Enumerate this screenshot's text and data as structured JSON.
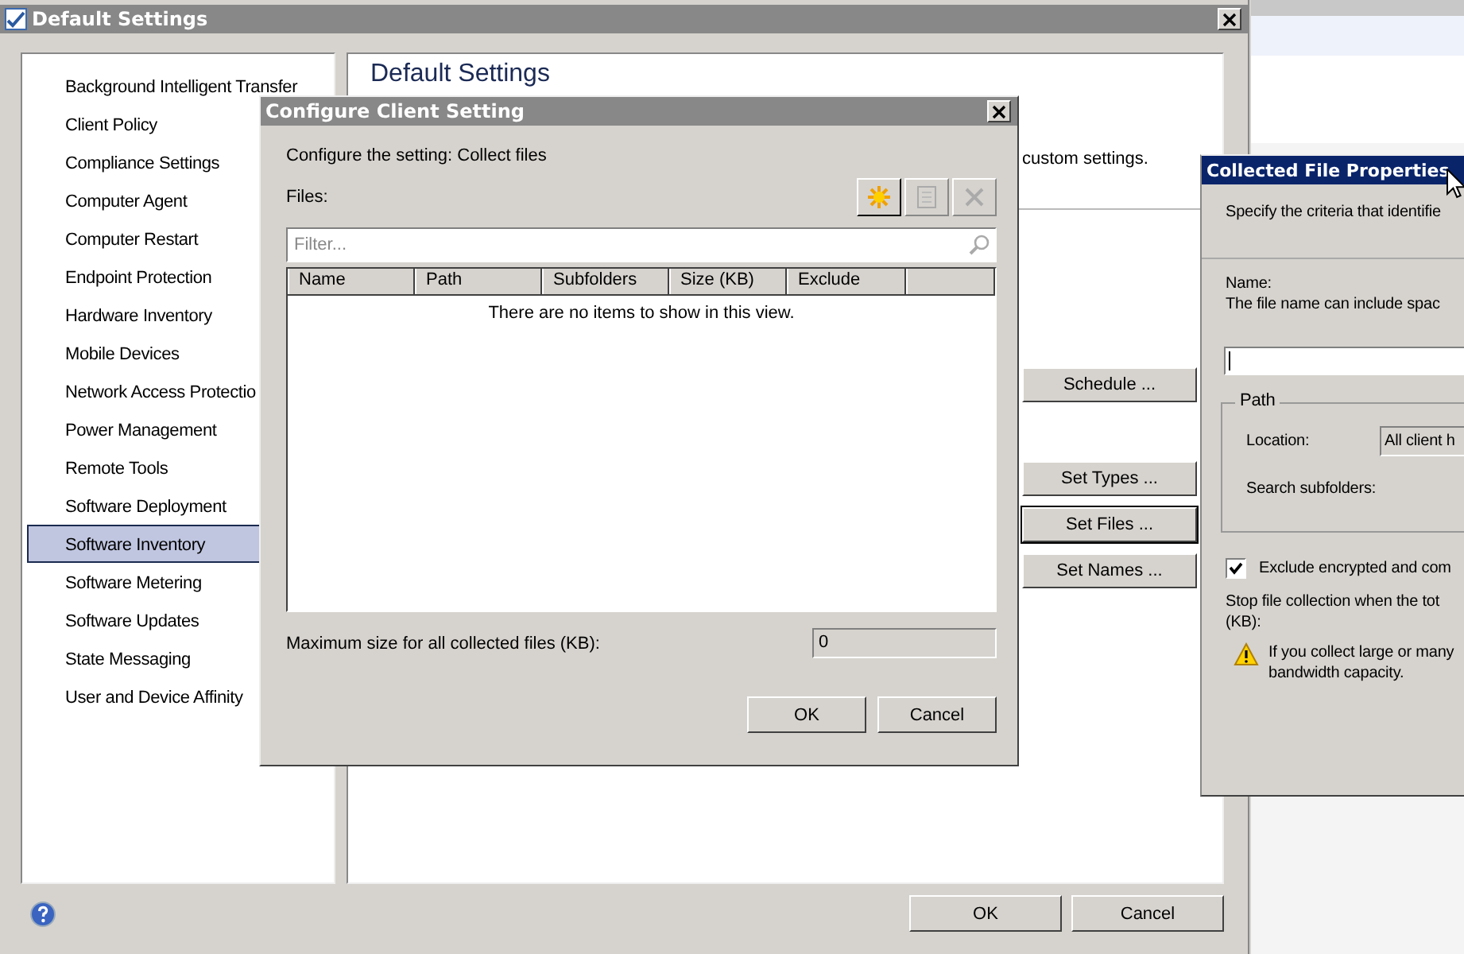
{
  "window": {
    "title": "Default Settings"
  },
  "sidebar": {
    "items": [
      {
        "label": "Background Intelligent Transfer",
        "selected": false
      },
      {
        "label": "Client Policy",
        "selected": false
      },
      {
        "label": "Compliance Settings",
        "selected": false
      },
      {
        "label": "Computer Agent",
        "selected": false
      },
      {
        "label": "Computer Restart",
        "selected": false
      },
      {
        "label": "Endpoint Protection",
        "selected": false
      },
      {
        "label": "Hardware Inventory",
        "selected": false
      },
      {
        "label": "Mobile Devices",
        "selected": false
      },
      {
        "label": "Network Access Protectio",
        "selected": false
      },
      {
        "label": "Power Management",
        "selected": false
      },
      {
        "label": "Remote Tools",
        "selected": false
      },
      {
        "label": "Software Deployment",
        "selected": false
      },
      {
        "label": "Software Inventory",
        "selected": true
      },
      {
        "label": "Software Metering",
        "selected": false
      },
      {
        "label": "Software Updates",
        "selected": false
      },
      {
        "label": "State Messaging",
        "selected": false
      },
      {
        "label": "User and Device Affinity",
        "selected": false
      }
    ]
  },
  "content": {
    "heading": "Default Settings",
    "description": "custom settings.",
    "buttons": [
      {
        "label": "Schedule ...",
        "focused": false
      },
      {
        "label": "Set Types ...",
        "focused": false
      },
      {
        "label": "Set Files ...",
        "focused": true
      },
      {
        "label": "Set Names ...",
        "focused": false
      }
    ]
  },
  "footer_buttons": [
    "OK",
    "Cancel"
  ],
  "configure_dialog": {
    "title": "Configure Client Setting",
    "prompt": "Configure the setting: Collect files",
    "files_label": "Files:",
    "toolbar": [
      {
        "kind": "new",
        "disabled": false
      },
      {
        "kind": "properties",
        "disabled": true
      },
      {
        "kind": "delete",
        "disabled": true
      }
    ],
    "filter": {
      "placeholder": "Filter..."
    },
    "columns": [
      "Name",
      "Path",
      "Subfolders",
      "Size (KB)",
      "Exclude"
    ],
    "empty_message": "There are no items to show in this view.",
    "max_size_label": "Maximum size for all collected files (KB):",
    "max_size_value": "0",
    "buttons": [
      "OK",
      "Cancel"
    ]
  },
  "properties_dialog": {
    "title": "Collected File Properties",
    "instruction": "Specify the criteria that identifie",
    "name_label": "Name:",
    "name_hint": "The file name can include spac",
    "path_group": {
      "title": "Path",
      "location_label": "Location:",
      "location_value": "All client h",
      "subfolders_label": "Search subfolders:"
    },
    "exclude": {
      "label": "Exclude encrypted and com",
      "checked": true
    },
    "stop_lines": [
      "Stop file collection when the tot",
      "(KB):"
    ],
    "warning_lines": [
      "If you collect large or many",
      "bandwidth capacity."
    ]
  }
}
